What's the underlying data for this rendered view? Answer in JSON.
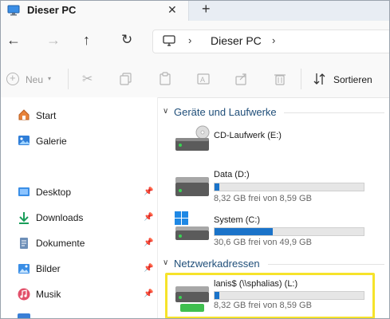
{
  "window": {
    "tab_title": "Dieser PC"
  },
  "address": {
    "location": "Dieser PC"
  },
  "toolbar": {
    "new_label": "Neu",
    "sort_label": "Sortieren"
  },
  "sidebar": {
    "items": [
      {
        "label": "Start",
        "icon": "home-icon"
      },
      {
        "label": "Galerie",
        "icon": "gallery-icon"
      },
      {
        "label": "Desktop",
        "icon": "desktop-folder-icon",
        "pinned": true
      },
      {
        "label": "Downloads",
        "icon": "download-icon",
        "pinned": true
      },
      {
        "label": "Dokumente",
        "icon": "documents-icon",
        "pinned": true
      },
      {
        "label": "Bilder",
        "icon": "pictures-icon",
        "pinned": true
      },
      {
        "label": "Musik",
        "icon": "music-icon",
        "pinned": true
      }
    ]
  },
  "groups": {
    "devices": {
      "label": "Geräte und Laufwerke"
    },
    "network": {
      "label": "Netzwerkadressen"
    }
  },
  "drives": {
    "cd": {
      "name": "CD-Laufwerk (E:)"
    },
    "data": {
      "name": "Data (D:)",
      "free": "8,32 GB frei von 8,59 GB",
      "used_fraction": 0.03
    },
    "system": {
      "name": "System (C:)",
      "free": "30,6 GB frei von 49,9 GB",
      "used_fraction": 0.39
    },
    "network": {
      "name": "lanis$ (\\\\sphalias) (L:)",
      "free": "8,32 GB frei von 8,59 GB",
      "used_fraction": 0.03
    }
  },
  "colors": {
    "accent": "#1a73c9",
    "highlight": "#f6e32a",
    "group_header": "#1f4e79"
  }
}
